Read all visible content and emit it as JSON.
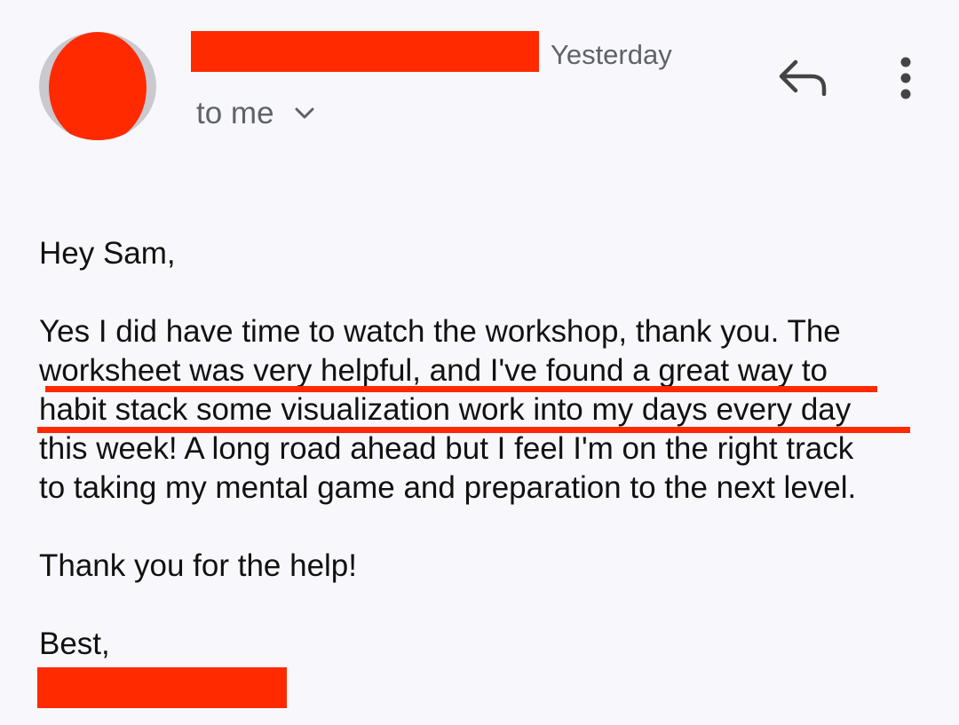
{
  "header": {
    "timestamp": "Yesterday",
    "recipient_label": "to me",
    "icons": {
      "expand": "chevron-down-icon",
      "reply": "reply-icon",
      "more": "more-vert-icon"
    }
  },
  "body": {
    "greeting": "Hey Sam,",
    "paragraph_lines": [
      "Yes I did have time to watch the workshop, thank you. The",
      "worksheet was very helpful, and I've found a great way to",
      "habit stack some visualization work into my days every day",
      "this week! A long road ahead but I feel I'm on the right track",
      "to taking my mental game and preparation to the next level."
    ],
    "thanks": "Thank you for the help!",
    "signoff": "Best,"
  },
  "colors": {
    "background": "#f8f8fc",
    "text": "#111111",
    "secondary_text": "#5f6368",
    "redaction": "#ff2a00"
  }
}
